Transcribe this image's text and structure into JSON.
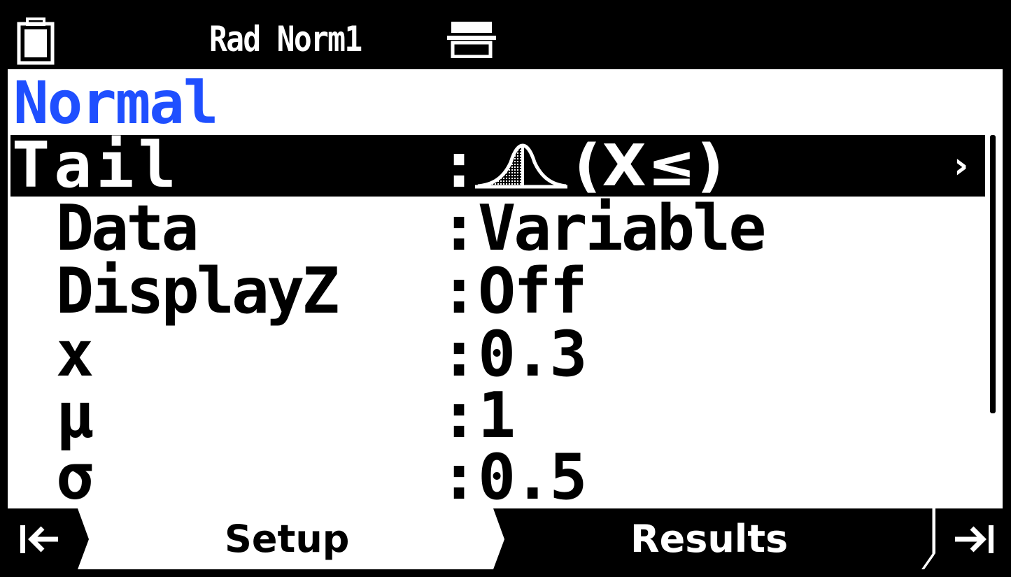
{
  "status": {
    "mode_text": "Rad Norm1",
    "icons": [
      "battery-icon",
      "calculator-icon"
    ]
  },
  "title": "Normal",
  "rows": [
    {
      "label": "Tail",
      "colon": ":",
      "value": "(X≤)",
      "icon": "normal-curve-left-shaded-icon",
      "selected": true
    },
    {
      "label": "Data",
      "colon": ":",
      "value": "Variable"
    },
    {
      "label": "DisplayZ",
      "colon": ":",
      "value": "Off"
    },
    {
      "label": "x",
      "colon": ":",
      "value": "0.3"
    },
    {
      "label": "μ",
      "colon": ":",
      "value": "1"
    },
    {
      "label": "σ",
      "colon": ":",
      "value": "0.5"
    }
  ],
  "softkeys": {
    "left_icon": "arrow-to-left-end-icon",
    "setup": "Setup",
    "results": "Results",
    "right_icon": "arrow-to-right-end-icon"
  },
  "colors": {
    "title_blue": "#1f4fff",
    "bar_black": "#000000",
    "background": "#ffffff"
  }
}
